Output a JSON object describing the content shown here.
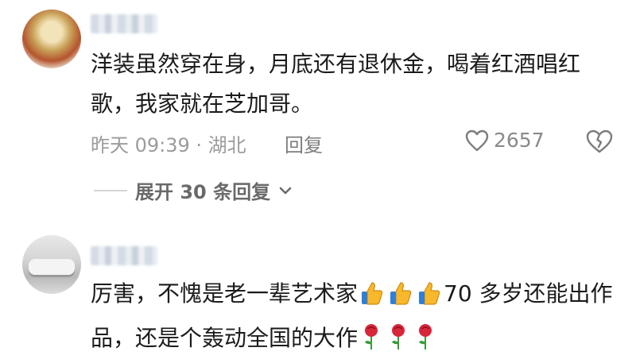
{
  "comments": [
    {
      "text": "洋装虽然穿在身，月底还有退休金，喝着红酒唱红歌，我家就在芝加哥。",
      "time_location": "昨天 09:39 · 湖北",
      "reply_label": "回复",
      "like_count": "2657",
      "expand_replies": "展开 30 条回复"
    },
    {
      "text_part1": "厉害，不愧是老一辈艺术家",
      "text_part2": "70 多岁还能出作品，还是个轰动全国的大作"
    }
  ],
  "icons": {
    "like": "heart-outline-icon",
    "dislike": "broken-heart-icon",
    "expand": "chevron-down-icon",
    "emoji_1": "thumbs-up-emoji",
    "emoji_2": "rose-emoji"
  },
  "colors": {
    "text": "#1b1b1b",
    "meta": "#9b9b9b",
    "emoji_yellow": "#f7b82c",
    "rose_red": "#d8263a"
  }
}
